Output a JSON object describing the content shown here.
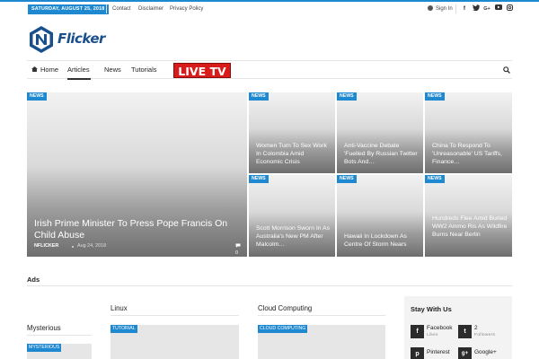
{
  "topbar": {
    "date": "SATURDAY, AUGUST 25, 2018",
    "links": [
      "Contact",
      "Disclaimer",
      "Privacy Policy"
    ],
    "sign_in": "Sign In",
    "social_icons": [
      "facebook-icon",
      "twitter-icon",
      "google-plus-icon",
      "youtube-icon",
      "instagram-icon"
    ]
  },
  "logo": {
    "text": "Flicker",
    "letter": "N"
  },
  "nav": {
    "items": [
      "Home",
      "Articles",
      "News",
      "Tutorials"
    ],
    "live_tv": "LIVE TV"
  },
  "featured": {
    "main": {
      "badge": "NEWS",
      "title": "Irish Prime Minister To Press Pope Francis On Child Abuse",
      "author": "NFLICKER",
      "date": "Aug 24, 2018",
      "comments": "0"
    },
    "tiles": [
      {
        "badge": "NEWS",
        "title": "Women Turn To Sex Work In Colombia Amid Economic Crisis"
      },
      {
        "badge": "NEWS",
        "title": "Anti-Vaccine Debate 'Fuelled By Russian Twitter Bots And…"
      },
      {
        "badge": "NEWS",
        "title": "China To Respond To 'Unreasonable' US Tariffs, Finance…"
      },
      {
        "badge": "NEWS",
        "title": "Scott Morrison Sworn In As Australia's New PM After Malcolm…"
      },
      {
        "badge": "NEWS",
        "title": "Hawaii In Lockdown As Centre Of Storm Nears"
      },
      {
        "badge": "NEWS",
        "title": "Hundreds Flee Amid Buried WW2 Ammo Ris As Wildfire Burns Near Berlin"
      }
    ]
  },
  "ads": {
    "label": "Ads"
  },
  "sections": [
    {
      "title": "Mysterious",
      "badge": "MYSTERIOUS"
    },
    {
      "title": "Linux",
      "badge": "TUTORIAL"
    },
    {
      "title": "Cloud Computing",
      "badge": "CLOUD COMPUTING"
    }
  ],
  "stay": {
    "title": "Stay With Us",
    "items": [
      {
        "icon": "facebook-icon",
        "glyph": "f",
        "name": "Facebook",
        "sub": "Likes"
      },
      {
        "icon": "twitter-icon",
        "glyph": "t",
        "name": "2",
        "sub": "Followers"
      },
      {
        "icon": "pinterest-icon",
        "glyph": "p",
        "name": "Pinterest",
        "sub": ""
      },
      {
        "icon": "google-plus-icon",
        "glyph": "g+",
        "name": "Google+",
        "sub": ""
      }
    ]
  },
  "colors": {
    "accent": "#1e88d0",
    "live": "#d81b1b",
    "logo": "#1a4f8e"
  }
}
